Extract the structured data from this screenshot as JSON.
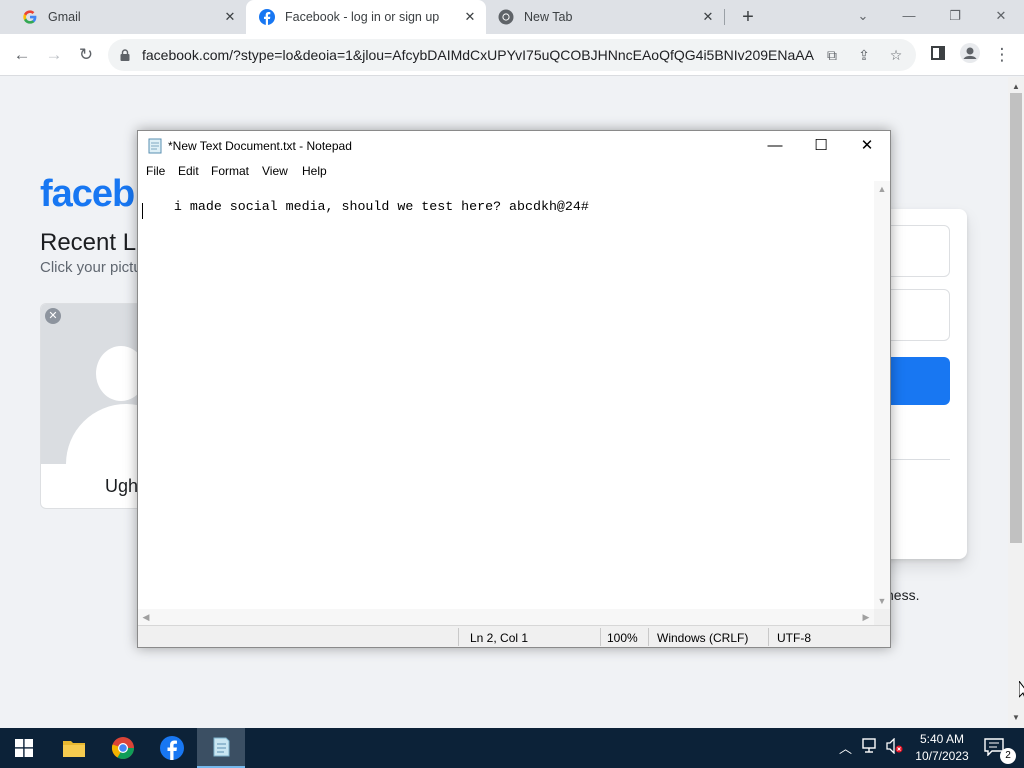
{
  "browser": {
    "tabs": [
      {
        "label": "Gmail",
        "icon": "gmail-icon"
      },
      {
        "label": "Facebook - log in or sign up",
        "icon": "facebook-icon",
        "active": true
      },
      {
        "label": "New Tab",
        "icon": "chrome-icon"
      }
    ],
    "url": "facebook.com/?stype=lo&deoia=1&jlou=AfcybDAIMdCxUPYvI75uQCOBJHNncEAoQfQG4i5BNIv209ENaAA..."
  },
  "page": {
    "logo": "faceb",
    "recent_title": "Recent L",
    "recent_subtitle": "Click your pictu",
    "profile_name": "Ugh",
    "login_partial_text": "ness."
  },
  "notepad": {
    "title": "*New Text Document.txt - Notepad",
    "menu": [
      "File",
      "Edit",
      "Format",
      "View",
      "Help"
    ],
    "content": "i made social media, should we test here? abcdkh@24#",
    "status": {
      "position": "Ln 2, Col 1",
      "zoom": "100%",
      "line_ending": "Windows (CRLF)",
      "encoding": "UTF-8"
    }
  },
  "taskbar": {
    "time": "5:40 AM",
    "date": "10/7/2023",
    "notification_count": "2"
  },
  "colors": {
    "facebook_blue": "#1877f2",
    "taskbar": "#0c2238"
  }
}
